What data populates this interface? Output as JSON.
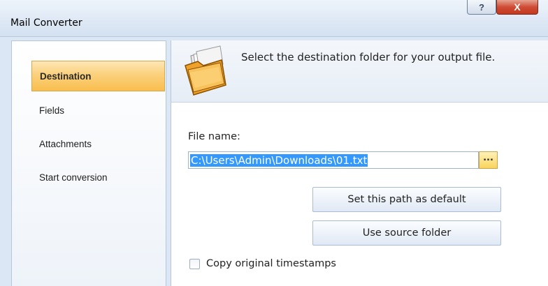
{
  "window": {
    "title": "Mail Converter",
    "help_label": "?",
    "close_label": "X"
  },
  "sidebar": {
    "items": [
      {
        "label": "Destination",
        "active": true
      },
      {
        "label": "Fields",
        "active": false
      },
      {
        "label": "Attachments",
        "active": false
      },
      {
        "label": "Start conversion",
        "active": false
      }
    ]
  },
  "header": {
    "description": "Select the destination folder for your output file.",
    "icon": "folder-icon"
  },
  "form": {
    "file_name_label": "File name:",
    "file_name_value": "C:\\Users\\Admin\\Downloads\\01.txt",
    "browse_label": "...",
    "set_default_label": "Set this path as default",
    "use_source_label": "Use source folder",
    "copy_timestamps_label": "Copy original timestamps",
    "copy_timestamps_checked": false
  }
}
